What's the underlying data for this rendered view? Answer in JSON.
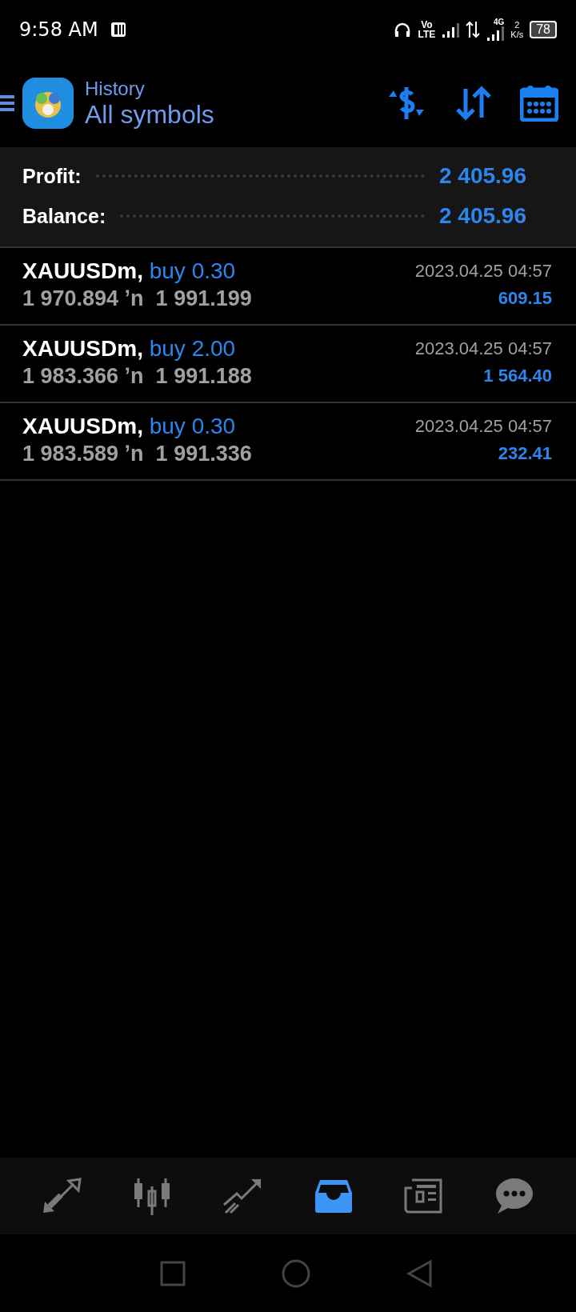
{
  "status_bar": {
    "time": "9:58 AM",
    "volte": [
      "Vo",
      "LTE"
    ],
    "network": "4G",
    "speed": [
      "2",
      "K/s"
    ],
    "battery": "78"
  },
  "header": {
    "subtitle": "History",
    "title": "All symbols"
  },
  "summary": [
    {
      "label": "Profit:",
      "value": "2 405.96"
    },
    {
      "label": "Balance:",
      "value": "2 405.96"
    }
  ],
  "deals": [
    {
      "symbol": "XAUUSDm,",
      "type": "buy 0.30",
      "prices": "1 970.894 ʼn  1 991.199",
      "time": "2023.04.25 04:57",
      "profit": "609.15"
    },
    {
      "symbol": "XAUUSDm,",
      "type": "buy 2.00",
      "prices": "1 983.366 ʼn  1 991.188",
      "time": "2023.04.25 04:57",
      "profit": "1 564.40"
    },
    {
      "symbol": "XAUUSDm,",
      "type": "buy 0.30",
      "prices": "1 983.589 ʼn  1 991.336",
      "time": "2023.04.25 04:57",
      "profit": "232.41"
    }
  ],
  "bottom_nav": [
    {
      "kind": "quotes",
      "selected": false
    },
    {
      "kind": "chart",
      "selected": false
    },
    {
      "kind": "trade",
      "selected": false
    },
    {
      "kind": "history",
      "selected": true
    },
    {
      "kind": "news",
      "selected": false
    },
    {
      "kind": "chat",
      "selected": false
    }
  ]
}
